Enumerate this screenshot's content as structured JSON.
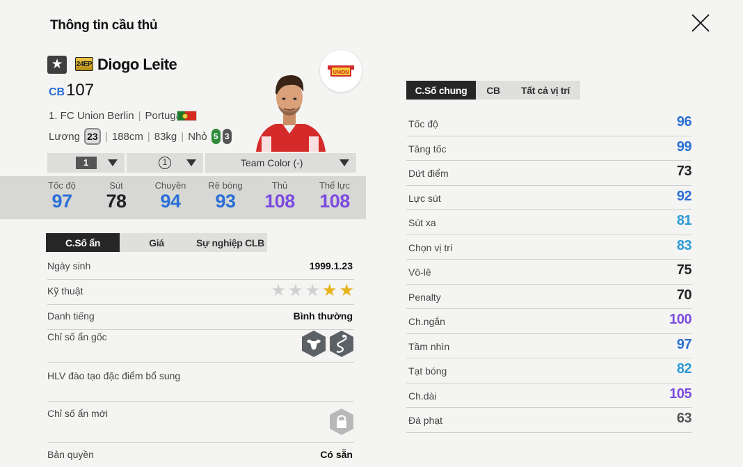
{
  "header": {
    "title": "Thông tin cầu thủ"
  },
  "player": {
    "star": "★",
    "season": "24EP",
    "name": "Diogo Leite",
    "position": "CB",
    "ovr": "107",
    "club": "1. FC Union Berlin",
    "nation": "Portugal",
    "salary_label": "Lương",
    "salary": "23",
    "height": "188cm",
    "weight": "83kg",
    "body_type": "Nhỏ",
    "weak_foot": "5",
    "strong_foot": "3",
    "club_logo_text": "UNION"
  },
  "dropdowns": {
    "level": "1",
    "grade": "1",
    "team_color": "Team Color (-)"
  },
  "main_stats": [
    {
      "label": "Tốc độ",
      "value": "97",
      "color": "#2a6fd6"
    },
    {
      "label": "Sút",
      "value": "78",
      "color": "#222222"
    },
    {
      "label": "Chuyền",
      "value": "94",
      "color": "#2a6fd6"
    },
    {
      "label": "Rê bóng",
      "value": "93",
      "color": "#2a6fd6"
    },
    {
      "label": "Thủ",
      "value": "108",
      "color": "#7b4be0"
    },
    {
      "label": "Thể lực",
      "value": "108",
      "color": "#7b4be0"
    }
  ],
  "left_tabs": [
    "C.Số ẩn",
    "Giá",
    "Sự nghiệp CLB"
  ],
  "details": {
    "birthday_label": "Ngày sinh",
    "birthday": "1999.1.23",
    "skill_label": "Kỹ thuật",
    "skill_stars": 2,
    "skill_max": 5,
    "reputation_label": "Danh tiếng",
    "reputation": "Bình thường",
    "traits_label": "Chỉ số ẩn gốc",
    "coach_label": "HLV đào tạo đặc điểm bổ sung",
    "new_traits_label": "Chỉ số ẩn mới",
    "license_label": "Bản quyền",
    "license": "Có sẵn"
  },
  "right_tabs": [
    "C.Số chung",
    "CB",
    "Tất cả vị trí"
  ],
  "stats": [
    {
      "label": "Tốc độ",
      "value": "96",
      "color": "#2a6fd6"
    },
    {
      "label": "Tăng tốc",
      "value": "99",
      "color": "#2a6fd6"
    },
    {
      "label": "Dứt điểm",
      "value": "73",
      "color": "#222222"
    },
    {
      "label": "Lực sút",
      "value": "92",
      "color": "#2a6fd6"
    },
    {
      "label": "Sút xa",
      "value": "81",
      "color": "#2a9ad6"
    },
    {
      "label": "Chọn vị trí",
      "value": "83",
      "color": "#2a9ad6"
    },
    {
      "label": "Vô-lê",
      "value": "75",
      "color": "#222222"
    },
    {
      "label": "Penalty",
      "value": "70",
      "color": "#222222"
    },
    {
      "label": "Ch.ngắn",
      "value": "100",
      "color": "#7b4be0"
    },
    {
      "label": "Tầm nhìn",
      "value": "97",
      "color": "#2a6fd6"
    },
    {
      "label": "Tạt bóng",
      "value": "82",
      "color": "#2a9ad6"
    },
    {
      "label": "Ch.dài",
      "value": "105",
      "color": "#7b4be0"
    },
    {
      "label": "Đá phạt",
      "value": "63",
      "color": "#555555"
    }
  ]
}
